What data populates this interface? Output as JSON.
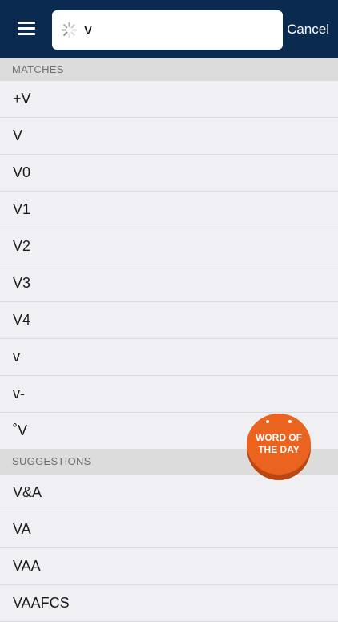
{
  "header": {
    "search_value": "v",
    "cancel_label": "Cancel"
  },
  "sections": {
    "matches_label": "MATCHES",
    "suggestions_label": "SUGGESTIONS"
  },
  "matches": [
    "+V",
    "V",
    "V0",
    "V1",
    "V2",
    "V3",
    "V4",
    "v",
    "v-",
    "˚V"
  ],
  "suggestions": [
    "V&A",
    "VA",
    "VAA",
    "VAAFCS"
  ],
  "word_of_day": {
    "line1": "WORD OF",
    "line2": "THE DAY"
  },
  "colors": {
    "header_bg": "#0b2a4f",
    "badge": "#ea6420"
  }
}
